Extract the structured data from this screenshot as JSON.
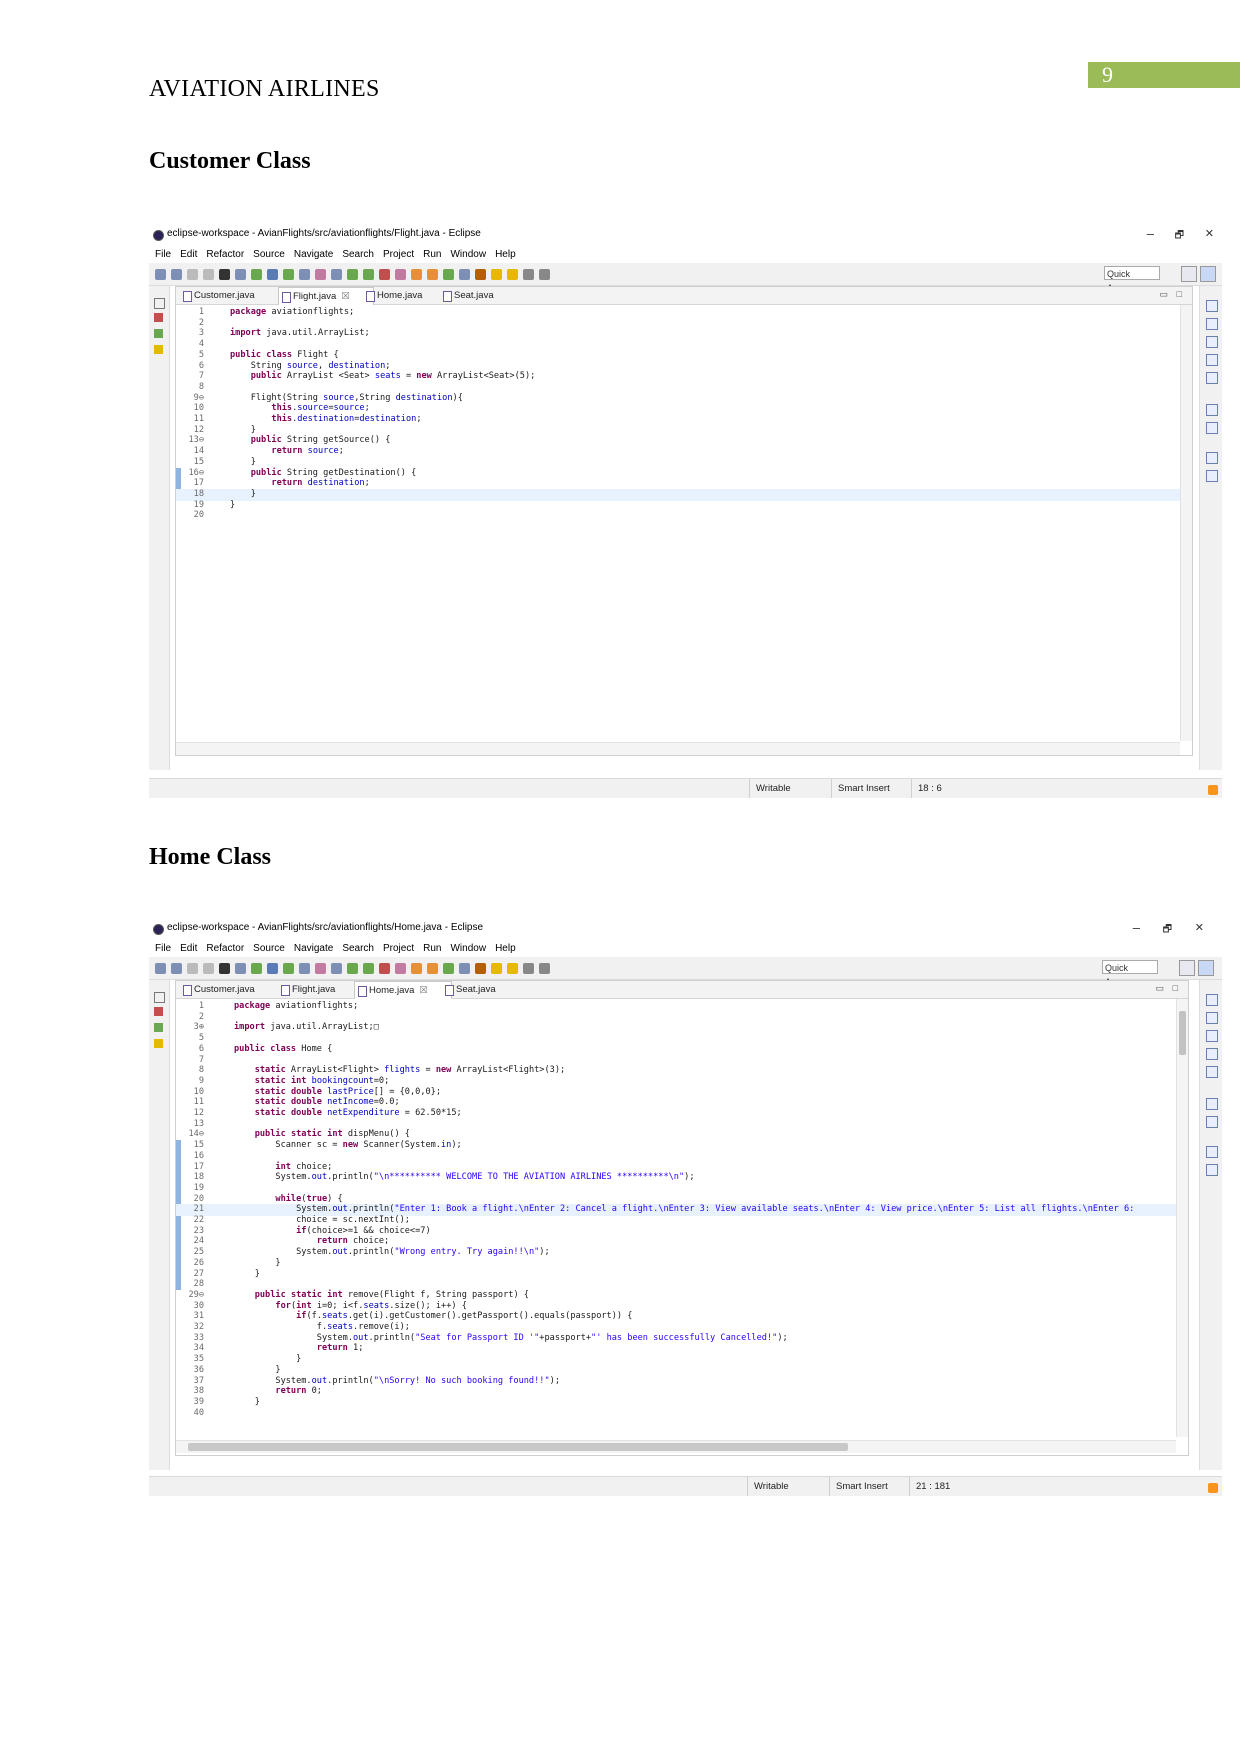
{
  "header": {
    "title": "AVIATION AIRLINES",
    "page_number": "9"
  },
  "sections": [
    {
      "heading": "Customer Class"
    },
    {
      "heading": "Home Class"
    }
  ],
  "window_controls": {
    "minimize": "–",
    "maximize": "🗗",
    "close": "✕"
  },
  "menu": [
    "File",
    "Edit",
    "Refactor",
    "Source",
    "Navigate",
    "Search",
    "Project",
    "Run",
    "Window",
    "Help"
  ],
  "quick_access": "Quick Access",
  "view_controls": {
    "minimize": "▭",
    "maximize": "□"
  },
  "screenshots": [
    {
      "window_title": "eclipse-workspace - AvianFlights/src/aviationflights/Flight.java - Eclipse",
      "tabs": [
        {
          "label": "Customer.java",
          "active": false
        },
        {
          "label": "Flight.java",
          "active": true
        },
        {
          "label": "Home.java",
          "active": false
        },
        {
          "label": "Seat.java",
          "active": false
        }
      ],
      "close_glyph": "☒",
      "lines": [
        {
          "n": "1",
          "t": "package aviationflights;"
        },
        {
          "n": "2",
          "t": ""
        },
        {
          "n": "3",
          "t": "import java.util.ArrayList;"
        },
        {
          "n": "4",
          "t": ""
        },
        {
          "n": "5",
          "t": "public class Flight {"
        },
        {
          "n": "6",
          "t": "    String source, destination;"
        },
        {
          "n": "7",
          "t": "    public ArrayList <Seat> seats = new ArrayList<Seat>(5);"
        },
        {
          "n": "8",
          "t": ""
        },
        {
          "n": "9⊖",
          "t": "    Flight(String source,String destination){"
        },
        {
          "n": "10",
          "t": "        this.source=source;"
        },
        {
          "n": "11",
          "t": "        this.destination=destination;"
        },
        {
          "n": "12",
          "t": "    }"
        },
        {
          "n": "13⊖",
          "t": "    public String getSource() {"
        },
        {
          "n": "14",
          "t": "        return source;"
        },
        {
          "n": "15",
          "t": "    }"
        },
        {
          "n": "16⊖",
          "t": "    public String getDestination() {"
        },
        {
          "n": "17",
          "t": "        return destination;"
        },
        {
          "n": "18",
          "t": "    }"
        },
        {
          "n": "19",
          "t": "}"
        },
        {
          "n": "20",
          "t": ""
        }
      ],
      "status": {
        "writable": "Writable",
        "insert_mode": "Smart Insert",
        "position": "18 : 6"
      }
    },
    {
      "window_title": "eclipse-workspace - AvianFlights/src/aviationflights/Home.java - Eclipse",
      "tabs": [
        {
          "label": "Customer.java",
          "active": false
        },
        {
          "label": "Flight.java",
          "active": false
        },
        {
          "label": "Home.java",
          "active": true
        },
        {
          "label": "Seat.java",
          "active": false
        }
      ],
      "close_glyph": "☒",
      "lines": [
        {
          "n": "1",
          "t": "package aviationflights;"
        },
        {
          "n": "2",
          "t": ""
        },
        {
          "n": "3⊕",
          "t": "import java.util.ArrayList;□"
        },
        {
          "n": "5",
          "t": ""
        },
        {
          "n": "6",
          "t": "public class Home {"
        },
        {
          "n": "7",
          "t": ""
        },
        {
          "n": "8",
          "t": "    static ArrayList<Flight> flights = new ArrayList<Flight>(3);"
        },
        {
          "n": "9",
          "t": "    static int bookingcount=0;"
        },
        {
          "n": "10",
          "t": "    static double lastPrice[] = {0,0,0};"
        },
        {
          "n": "11",
          "t": "    static double netIncome=0.0;"
        },
        {
          "n": "12",
          "t": "    static double netExpenditure = 62.50*15;"
        },
        {
          "n": "13",
          "t": ""
        },
        {
          "n": "14⊖",
          "t": "    public static int dispMenu() {"
        },
        {
          "n": "15",
          "t": "        Scanner sc = new Scanner(System.in);"
        },
        {
          "n": "16",
          "t": ""
        },
        {
          "n": "17",
          "t": "        int choice;"
        },
        {
          "n": "18",
          "t": "        System.out.println(\"\\n********** WELCOME TO THE AVIATION AIRLINES **********\\n\");"
        },
        {
          "n": "19",
          "t": ""
        },
        {
          "n": "20",
          "t": "        while(true) {"
        },
        {
          "n": "21",
          "t": "            System.out.println(\"Enter 1: Book a flight.\\nEnter 2: Cancel a flight.\\nEnter 3: View available seats.\\nEnter 4: View price.\\nEnter 5: List all flights.\\nEnter 6:"
        },
        {
          "n": "22",
          "t": "            choice = sc.nextInt();"
        },
        {
          "n": "23",
          "t": "            if(choice>=1 && choice<=7)"
        },
        {
          "n": "24",
          "t": "                return choice;"
        },
        {
          "n": "25",
          "t": "            System.out.println(\"Wrong entry. Try again!!\\n\");"
        },
        {
          "n": "26",
          "t": "        }"
        },
        {
          "n": "27",
          "t": "    }"
        },
        {
          "n": "28",
          "t": ""
        },
        {
          "n": "29⊖",
          "t": "    public static int remove(Flight f, String passport) {"
        },
        {
          "n": "30",
          "t": "        for(int i=0; i<f.seats.size(); i++) {"
        },
        {
          "n": "31",
          "t": "            if(f.seats.get(i).getCustomer().getPassport().equals(passport)) {"
        },
        {
          "n": "32",
          "t": "                f.seats.remove(i);"
        },
        {
          "n": "33",
          "t": "                System.out.println(\"Seat for Passport ID '\"+passport+\"' has been successfully Cancelled!\");"
        },
        {
          "n": "34",
          "t": "                return 1;"
        },
        {
          "n": "35",
          "t": "            }"
        },
        {
          "n": "36",
          "t": "        }"
        },
        {
          "n": "37",
          "t": "        System.out.println(\"\\nSorry! No such booking found!!\");"
        },
        {
          "n": "38",
          "t": "        return 0;"
        },
        {
          "n": "39",
          "t": "    }"
        },
        {
          "n": "40",
          "t": ""
        }
      ],
      "status": {
        "writable": "Writable",
        "insert_mode": "Smart Insert",
        "position": "21 : 181"
      }
    }
  ],
  "colors": {
    "page_badge": "#9bbb59",
    "keyword": "#7f0055",
    "string": "#2a00ff",
    "field": "#0000c0",
    "current_line": "#e8f2fe"
  },
  "icons": [
    "eclipse-icon",
    "minimize-icon",
    "maximize-icon",
    "close-icon",
    "java-file-icon",
    "quick-access-icon",
    "perspective-icon",
    "feed-icon"
  ]
}
